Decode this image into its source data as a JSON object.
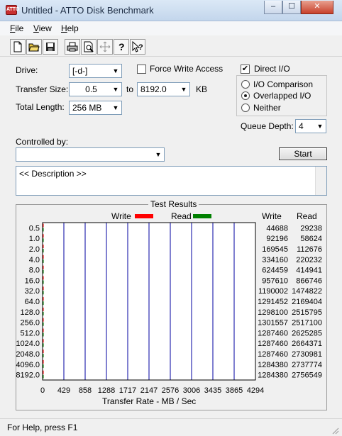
{
  "window": {
    "title": "Untitled - ATTO Disk Benchmark",
    "icon_text": "ATTO"
  },
  "titlebar_buttons": {
    "minimize": "–",
    "maximize": "☐",
    "close": "✕"
  },
  "menu": [
    {
      "label": "File",
      "mnemonic": "F",
      "rest": "ile"
    },
    {
      "label": "View",
      "mnemonic": "V",
      "rest": "iew"
    },
    {
      "label": "Help",
      "mnemonic": "H",
      "rest": "elp"
    }
  ],
  "toolbar": {
    "icons": [
      "new-icon",
      "open-icon",
      "save-icon",
      "print-icon",
      "print-preview-icon",
      "move-icon",
      "help-icon",
      "context-help-icon"
    ]
  },
  "drive": {
    "label": "Drive:",
    "value": "[-d-]"
  },
  "force_write": {
    "label": "Force Write Access",
    "checked": false
  },
  "direct_io": {
    "label": "Direct I/O",
    "checked": true
  },
  "transfer_size": {
    "label": "Transfer Size:",
    "from": "0.5",
    "to_label": "to",
    "to": "8192.0",
    "unit": "KB"
  },
  "total_length": {
    "label": "Total Length:",
    "value": "256 MB"
  },
  "mode": {
    "options": [
      "I/O Comparison",
      "Overlapped I/O",
      "Neither"
    ],
    "selected": "Overlapped I/O"
  },
  "queue_depth": {
    "label": "Queue Depth:",
    "value": "4"
  },
  "controlled_by": {
    "label": "Controlled by:",
    "value": ""
  },
  "start_button": {
    "label": "Start"
  },
  "description": {
    "text": "<< Description >>"
  },
  "results": {
    "title": "Test Results",
    "legend_write": "Write",
    "legend_read": "Read",
    "col_write": "Write",
    "col_read": "Read",
    "xlabel": "Transfer Rate - MB / Sec",
    "colors": {
      "write": "#ff0000",
      "read": "#008000",
      "grid": "#0000a0"
    }
  },
  "chart_data": {
    "type": "bar",
    "orientation": "horizontal",
    "title": "Test Results",
    "xlabel": "Transfer Rate - MB / Sec",
    "xlim": [
      0,
      4294
    ],
    "x_ticks": [
      "0",
      "429",
      "858",
      "1288",
      "1717",
      "2147",
      "2576",
      "3006",
      "3435",
      "3865",
      "4294"
    ],
    "categories": [
      "0.5",
      "1.0",
      "2.0",
      "4.0",
      "8.0",
      "16.0",
      "32.0",
      "64.0",
      "128.0",
      "256.0",
      "512.0",
      "1024.0",
      "2048.0",
      "4096.0",
      "8192.0"
    ],
    "series": [
      {
        "name": "Write",
        "values": [
          44688,
          92196,
          169545,
          334160,
          624459,
          957610,
          1190002,
          1291452,
          1298100,
          1301557,
          1287460,
          1287460,
          1287460,
          1284380,
          1284380
        ]
      },
      {
        "name": "Read",
        "values": [
          29238,
          58624,
          112676,
          220232,
          414941,
          866746,
          1474822,
          2169404,
          2515795,
          2517100,
          2625285,
          2664371,
          2730981,
          2737774,
          2756549
        ]
      }
    ],
    "grid": true
  },
  "status": {
    "text": "For Help, press F1"
  }
}
